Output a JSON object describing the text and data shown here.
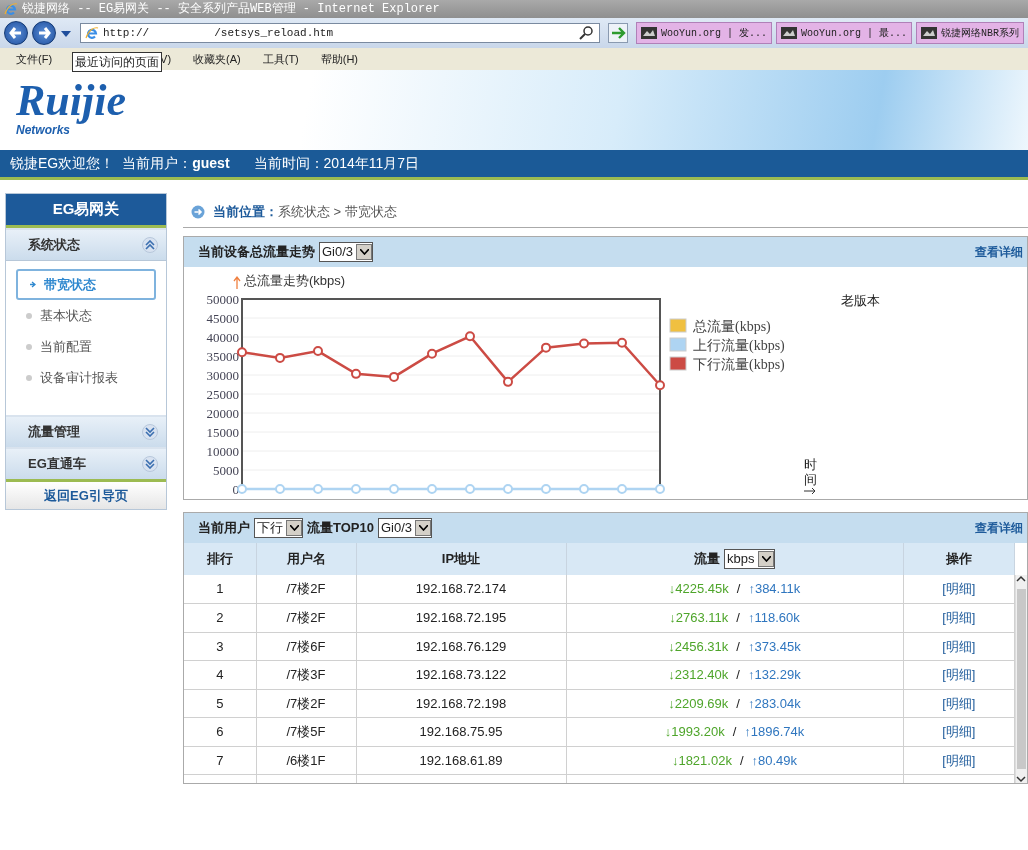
{
  "window": {
    "title": "锐捷网络 -- EG易网关 -- 安全系列产品WEB管理 - Internet Explorer"
  },
  "address_bar": {
    "url_start": "http://",
    "url_end": "/setsys_reload.htm"
  },
  "browser_tabs": [
    {
      "label": "WooYun.org | 发..."
    },
    {
      "label": "WooYun.org | 最..."
    },
    {
      "label": "锐捷网络NBR系列"
    }
  ],
  "menu": [
    "文件(F)",
    "V)",
    "收藏夹(A)",
    "工具(T)",
    "帮助(H)"
  ],
  "tooltip": "最近访问的页面",
  "header": {
    "logo": "Ruijie",
    "logo_sub": "Networks",
    "welcome": "锐捷EG欢迎您！",
    "user_label": "当前用户：",
    "user": "guest",
    "time": "当前时间：2014年11月7日"
  },
  "sidebar": {
    "title": "EG易网关",
    "sections": [
      {
        "label": "系统状态",
        "expanded": true,
        "items": [
          {
            "label": "带宽状态",
            "selected": true
          },
          {
            "label": "基本状态",
            "selected": false
          },
          {
            "label": "当前配置",
            "selected": false
          },
          {
            "label": "设备审计报表",
            "selected": false
          }
        ]
      },
      {
        "label": "流量管理",
        "expanded": false
      },
      {
        "label": "EG直通车",
        "expanded": false
      }
    ],
    "back_link": "返回EG引导页"
  },
  "breadcrumb": {
    "label": "当前位置：",
    "path": "系统状态 > 带宽状态"
  },
  "trend_panel": {
    "title": "当前设备总流量走势",
    "interface": "Gi0/3",
    "details": "查看详细",
    "old_version": "老版本",
    "chart_data": {
      "type": "line",
      "grid": true,
      "legend": true,
      "ylabel": "总流量走势(kbps)",
      "xlabel": "时间",
      "ylim": [
        0,
        50000
      ],
      "yticks": [
        0,
        5000,
        10000,
        15000,
        20000,
        25000,
        30000,
        35000,
        40000,
        45000,
        50000
      ],
      "series": [
        {
          "name": "总流量(kbps)",
          "color": "#f0c040",
          "values": [
            null,
            null,
            null,
            null,
            null,
            null,
            null,
            null,
            null,
            null,
            null,
            null
          ]
        },
        {
          "name": "上行流量(kbps)",
          "color": "#aed4f2",
          "marker": "circle",
          "values": [
            0,
            0,
            0,
            0,
            0,
            0,
            0,
            0,
            0,
            0,
            0,
            0
          ]
        },
        {
          "name": "下行流量(kbps)",
          "color": "#cc4b44",
          "marker": "circle",
          "values": [
            36000,
            34500,
            36300,
            30300,
            29500,
            35600,
            40200,
            28200,
            37200,
            38300,
            38500,
            27300
          ]
        }
      ]
    }
  },
  "top_panel": {
    "label": "当前用户",
    "direction": "下行",
    "title": "流量TOP10",
    "interface": "Gi0/3",
    "details": "查看详细",
    "columns": [
      "排行",
      "用户名",
      "IP地址",
      "流量",
      "操作"
    ],
    "unit": "kbps",
    "rows": [
      {
        "rank": "1",
        "user": "/7楼2F",
        "ip": "192.168.72.174",
        "down": "↓4225.45k",
        "sep": "/",
        "up": "↑384.11k",
        "action": "[明细]"
      },
      {
        "rank": "2",
        "user": "/7楼2F",
        "ip": "192.168.72.195",
        "down": "↓2763.11k",
        "sep": "/",
        "up": "↑118.60k",
        "action": "[明细]"
      },
      {
        "rank": "3",
        "user": "/7楼6F",
        "ip": "192.168.76.129",
        "down": "↓2456.31k",
        "sep": "/",
        "up": "↑373.45k",
        "action": "[明细]"
      },
      {
        "rank": "4",
        "user": "/7楼3F",
        "ip": "192.168.73.122",
        "down": "↓2312.40k",
        "sep": "/",
        "up": "↑132.29k",
        "action": "[明细]"
      },
      {
        "rank": "5",
        "user": "/7楼2F",
        "ip": "192.168.72.198",
        "down": "↓2209.69k",
        "sep": "/",
        "up": "↑283.04k",
        "action": "[明细]"
      },
      {
        "rank": "6",
        "user": "/7楼5F",
        "ip": "192.168.75.95",
        "down": "↓1993.20k",
        "sep": "/",
        "up": "↑1896.74k",
        "action": "[明细]"
      },
      {
        "rank": "7",
        "user": "/6楼1F",
        "ip": "192.168.61.89",
        "down": "↓1821.02k",
        "sep": "/",
        "up": "↑80.49k",
        "action": "[明细]"
      }
    ]
  }
}
